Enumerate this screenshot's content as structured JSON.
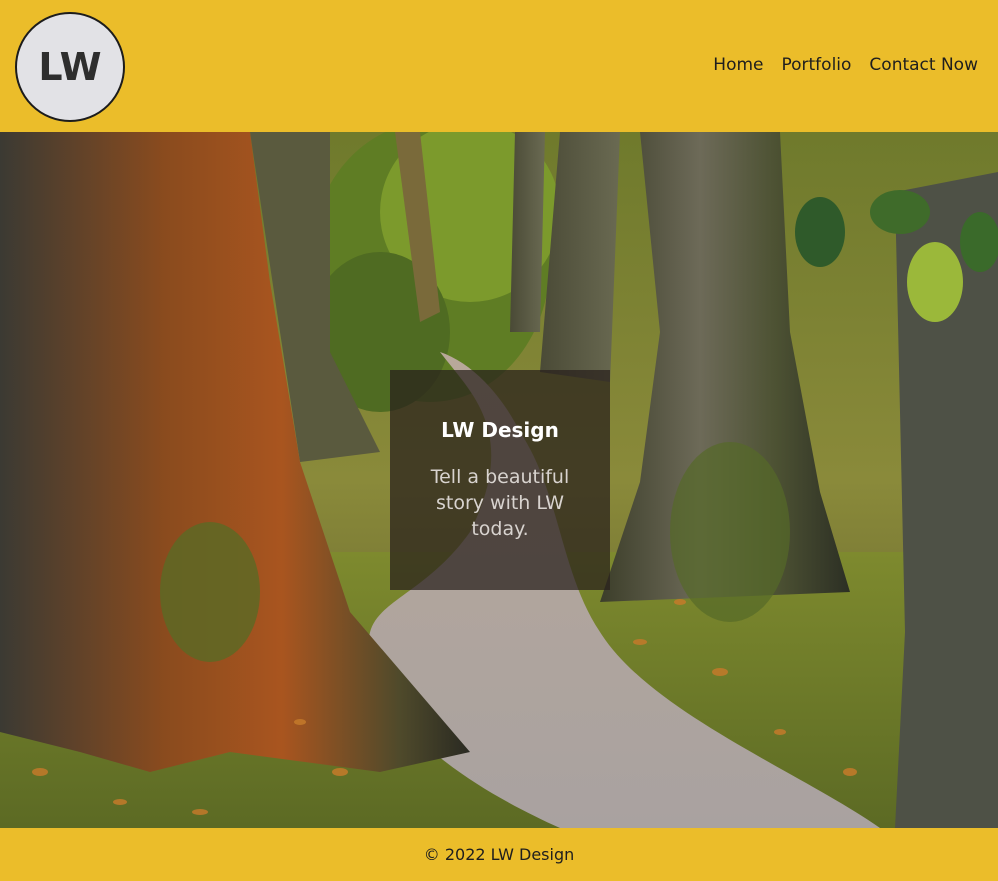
{
  "header": {
    "logo_text": "LW",
    "nav": [
      {
        "label": "Home"
      },
      {
        "label": "Portfolio"
      },
      {
        "label": "Contact Now"
      }
    ]
  },
  "hero": {
    "title": "LW Design",
    "tagline": "Tell a beautiful story with LW today."
  },
  "footer": {
    "copyright": "© 2022 LW Design"
  },
  "colors": {
    "accent": "#ebbd2a",
    "logo_bg": "#e2e2e6",
    "overlay": "#28201c"
  }
}
